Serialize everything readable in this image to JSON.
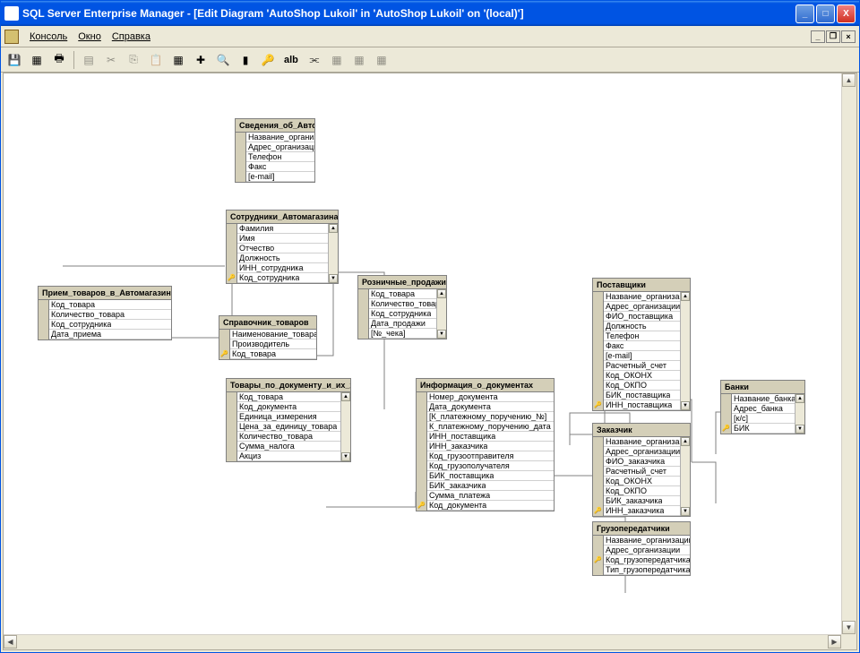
{
  "titlebar": {
    "title": "SQL Server Enterprise Manager - [Edit Diagram 'AutoShop Lukoil' in 'AutoShop Lukoil' on '(local)']"
  },
  "menu": {
    "console": "Консоль",
    "window": "Окно",
    "help": "Справка"
  },
  "toolbar": {
    "ab_label": "alb"
  },
  "tables": {
    "svedeniya": {
      "title": "Сведения_об_Автомага:",
      "fields": [
        "Название_организации",
        "Адрес_организации",
        "Телефон",
        "Факс",
        "[e-mail]"
      ]
    },
    "sotrudniki": {
      "title": "Сотрудники_Автомагазина",
      "fields": [
        "Фамилия",
        "Имя",
        "Отчество",
        "Должность",
        "ИНН_сотрудника",
        "Код_сотрудника"
      ],
      "key_index": 5
    },
    "priem": {
      "title": "Прием_товаров_в_Автомагазин",
      "fields": [
        "Код_товара",
        "Количество_товара",
        "Код_сотрудника",
        "Дата_приема"
      ]
    },
    "spravochnik": {
      "title": "Справочник_товаров",
      "fields": [
        "Наименование_товара",
        "Производитель",
        "Код_товара"
      ],
      "key_index": 2
    },
    "roznica": {
      "title": "Розничные_продажи",
      "fields": [
        "Код_товара",
        "Количество_товара",
        "Код_сотрудника",
        "Дата_продажи",
        "[№_чека]"
      ]
    },
    "tovary_doc": {
      "title": "Товары_по_документу_и_их_хар:",
      "fields": [
        "Код_товара",
        "Код_документа",
        "Единица_измерения",
        "Цена_за_единицу_товара",
        "Количество_товара",
        "Сумма_налога",
        "Акциз"
      ]
    },
    "info_doc": {
      "title": "Информация_о_документах",
      "fields": [
        "Номер_документа",
        "Дата_документа",
        "[К_платежному_поручению_№]",
        "К_платежному_поручению_дата",
        "ИНН_поставщика",
        "ИНН_заказчика",
        "Код_грузоотправителя",
        "Код_грузополучателя",
        "БИК_поставщика",
        "БИК_заказчика",
        "Сумма_платежа",
        "Код_документа"
      ],
      "key_index": 11
    },
    "postavshiki": {
      "title": "Поставщики",
      "fields": [
        "Название_организаци",
        "Адрес_организации",
        "ФИО_поставщика",
        "Должность",
        "Телефон",
        "Факс",
        "[e-mail]",
        "Расчетный_счет",
        "Код_ОКОНХ",
        "Код_ОКПО",
        "БИК_поставщика",
        "ИНН_поставщика"
      ],
      "key_index": 11
    },
    "zakazchik": {
      "title": "Заказчик",
      "fields": [
        "Название_организаци",
        "Адрес_организации",
        "ФИО_заказчика",
        "Расчетный_счет",
        "Код_ОКОНХ",
        "Код_ОКПО",
        "БИК_заказчика",
        "ИНН_заказчика"
      ],
      "key_index": 7
    },
    "banki": {
      "title": "Банки",
      "fields": [
        "Название_банка",
        "Адрес_банка",
        "[к/с]",
        "БИК"
      ],
      "key_index": 3
    },
    "gruz": {
      "title": "Грузопередатчики",
      "fields": [
        "Название_организации",
        "Адрес_организации",
        "Код_грузопередатчика",
        "Тип_грузопередатчика"
      ],
      "key_index": 2
    }
  }
}
